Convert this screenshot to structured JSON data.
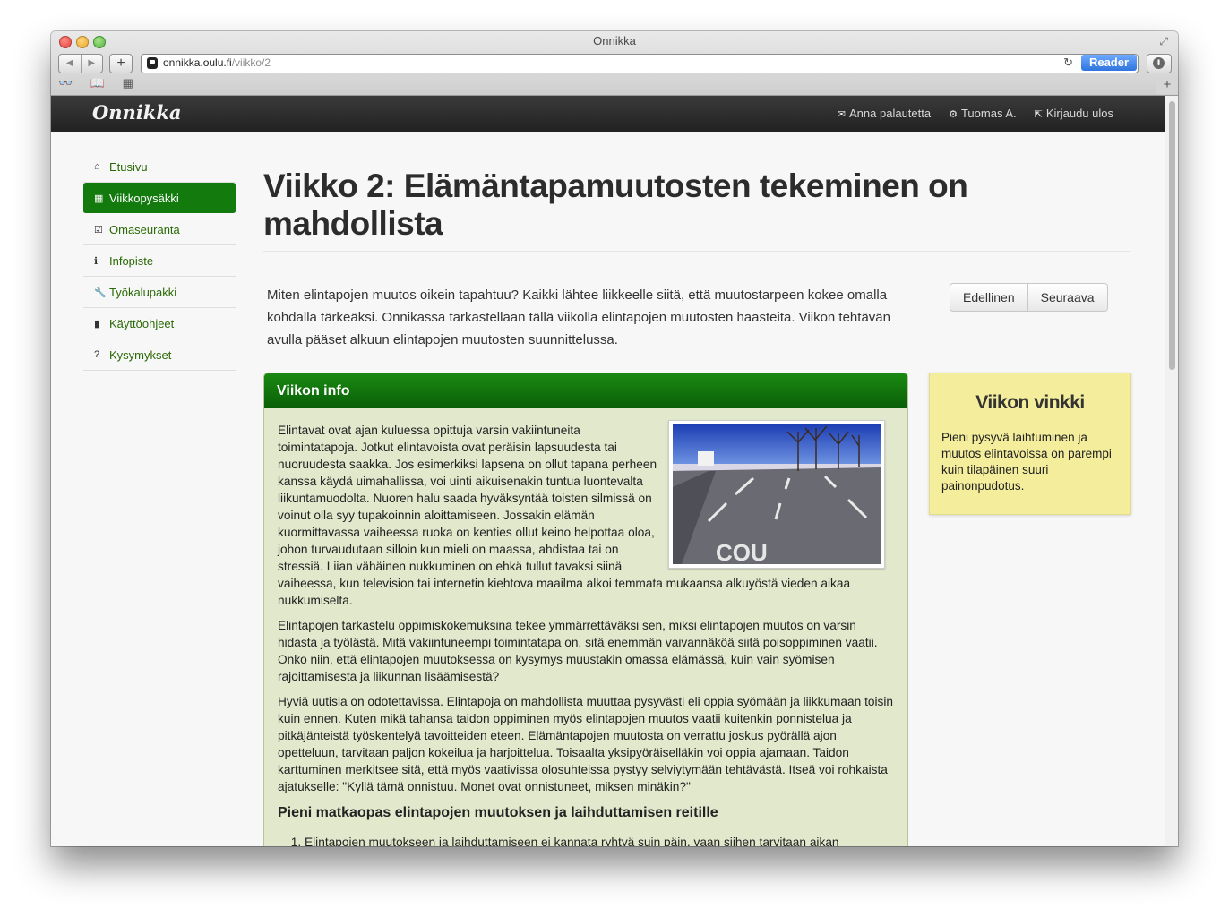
{
  "browser": {
    "title": "Onnikka",
    "url_host": "onnikka.oulu.fi",
    "url_path": "/viikko/2",
    "reader_label": "Reader",
    "back_icon": "◀",
    "forward_icon": "▶",
    "plus_label": "+",
    "reload_icon": "↻",
    "fullscreen_icon": "⤢",
    "bookmarks_icons": "👓 📖 ▦",
    "newtab_label": "+"
  },
  "navbar": {
    "brand": "Onnikka",
    "links": [
      {
        "icon": "✉",
        "icon_name": "envelope-icon",
        "label": "Anna palautetta"
      },
      {
        "icon": "⚙",
        "icon_name": "gear-icon",
        "label": "Tuomas A."
      },
      {
        "icon": "⇱",
        "icon_name": "logout-icon",
        "label": "Kirjaudu ulos"
      }
    ]
  },
  "sidebar": {
    "items": [
      {
        "icon": "⌂",
        "label": "Etusivu"
      },
      {
        "icon": "▦",
        "label": "Viikkopysäkki",
        "active": true
      },
      {
        "icon": "☑",
        "label": "Omaseuranta"
      },
      {
        "icon": "ℹ",
        "label": "Infopiste"
      },
      {
        "icon": "🔧",
        "label": "Työkalupakki"
      },
      {
        "icon": "▮",
        "label": "Käyttöohjeet"
      },
      {
        "icon": "?",
        "label": "Kysymykset"
      }
    ]
  },
  "main": {
    "title": "Viikko 2: Elämäntapamuutosten tekeminen on mahdollista",
    "intro": "Miten elintapojen muutos oikein tapahtuu? Kaikki lähtee liikkeelle siitä, että muutostarpeen kokee omalla kohdalla tärkeäksi. Onnikassa tarkastellaan tällä viikolla elintapojen muutosten haasteita. Viikon tehtävän avulla pääset alkuun elintapojen muutosten suunnittelussa.",
    "prev_label": "Edellinen",
    "next_label": "Seuraava"
  },
  "info": {
    "heading": "Viikon info",
    "paragraphs": [
      "Elintavat ovat ajan kuluessa opittuja varsin vakiintuneita toimintatapoja. Jotkut elintavoista ovat peräisin lapsuudesta tai nuoruudesta saakka. Jos esimerkiksi lapsena on ollut tapana perheen kanssa käydä uimahallissa, voi uinti aikuisenakin tuntua luontevalta liikuntamuodolta. Nuoren halu saada hyväksyntää toisten silmissä on voinut olla syy tupakoinnin aloittamiseen. Jossakin elämän kuormittavassa vaiheessa ruoka on kenties ollut keino helpottaa oloa, johon turvaudutaan silloin kun mieli on maassa, ahdistaa tai on stressiä. Liian vähäinen nukkuminen on ehkä tullut tavaksi siinä vaiheessa, kun television tai internetin kiehtova maailma alkoi temmata mukaansa alkuyöstä vieden aikaa nukkumiselta.",
      "Elintapojen tarkastelu oppimiskokemuksina tekee ymmärrettäväksi sen, miksi elintapojen muutos on varsin hidasta ja työlästä. Mitä vakiintuneempi toimintatapa on, sitä enemmän vaivannäköä siitä poisoppiminen vaatii. Onko niin, että elintapojen muutoksessa on kysymys muustakin omassa elämässä, kuin vain syömisen rajoittamisesta ja liikunnan lisäämisestä?",
      "Hyviä uutisia on odotettavissa. Elintapoja on mahdollista muuttaa pysyvästi eli oppia syömään ja liikkumaan toisin kuin ennen. Kuten mikä tahansa taidon oppiminen myös elintapojen muutos vaatii kuitenkin ponnistelua ja pitkäjänteistä työskentelyä tavoitteiden eteen. Elämäntapojen muutosta on verrattu joskus pyörällä ajon opetteluun, tarvitaan paljon kokeilua ja harjoittelua. Toisaalta yksipyöräiselläkin voi oppia ajamaan. Taidon karttuminen merkitsee sitä, että myös vaativissa olosuhteissa pystyy selviytymään tehtävästä. Itseä voi rohkaista ajatukselle: \"Kyllä tämä onnistuu. Monet ovat onnistuneet, miksen minäkin?\""
    ],
    "subheading": "Pieni matkaopas elintapojen muutoksen ja laihduttamisen reitille",
    "list": [
      "Elintapojen muutokseen ja laihduttamiseen ei kannata ryhtyä suin päin, vaan siihen tarvitaan aikan"
    ]
  },
  "vinkki": {
    "heading": "Viikon vinkki",
    "text": "Pieni pysyvä laihtuminen ja muutos elintavoissa on parempi kuin tilapäinen suuri painonpudotus."
  }
}
